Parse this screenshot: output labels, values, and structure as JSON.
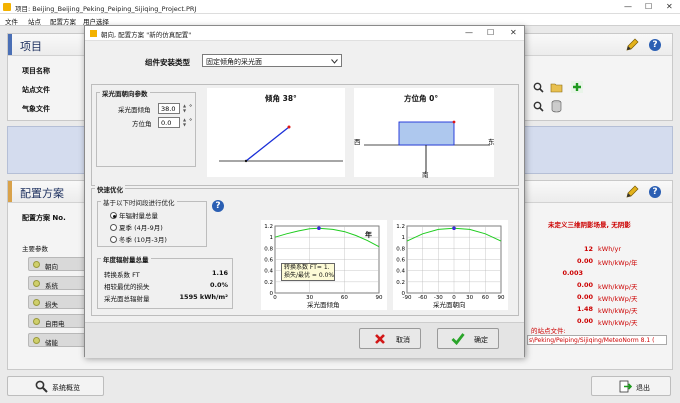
{
  "window": {
    "title": "项目:  Beijing_Beijing_Peking_Peiping_Sijiqing_Project.PRJ",
    "minimize": "—",
    "maximize": "☐",
    "close": "✕"
  },
  "menu": {
    "items": [
      "文件",
      "站点",
      "配置方案",
      "用户选择"
    ]
  },
  "project_panel": {
    "title": "项目",
    "rows": [
      "项目名称",
      "站点文件",
      "气象文件"
    ]
  },
  "config_panel": {
    "title": "配置方案",
    "config_label": "配置方案 No.",
    "main_params": "主要参数",
    "items": [
      "朝向",
      "系统",
      "损失",
      "自用电",
      "储能"
    ],
    "right_heading": "未定义三维阴影场景, 无阴影",
    "right_values": [
      {
        "value": "12",
        "unit": "kWh/yr"
      },
      {
        "value": "0.00",
        "unit": "kWh/kWp/年"
      },
      {
        "value": "0.003",
        "unit": ""
      },
      {
        "value": "0.00",
        "unit": "kWh/kWp/天"
      },
      {
        "value": "0.00",
        "unit": "kWh/kWp/天"
      },
      {
        "value": "1.48",
        "unit": "kWh/kWp/天"
      },
      {
        "value": "0.00",
        "unit": "kWh/kWp/天"
      }
    ],
    "site_file_label": "的站点文件:",
    "site_file_value": "s\\Peking/Peiping/Sijiqing/MeteoNorm 8.1 ("
  },
  "bottom": {
    "overview": "系统概览",
    "exit": "退出"
  },
  "dialog": {
    "title": "朝向, 配置方案 \"新的仿真配置\"",
    "install_type_label": "组件安装类型",
    "install_type_value": "固定倾角的采光面",
    "orientation_group": "采光面朝向参数",
    "tilt_label": "采光面倾角",
    "tilt_value": "38.0",
    "azimuth_label": "方位角",
    "azimuth_value": "0.0",
    "deg": "°",
    "tilt_fig_label": "倾角 38°",
    "azimuth_fig_label": "方位角 0°",
    "west": "西",
    "east": "东",
    "south": "南",
    "quick_opt": "快速优化",
    "opt_basis_group": "基于以下时间段进行优化",
    "opt_options": [
      "年辐射量总量",
      "夏季 (4月-9月)",
      "冬季 (10月-3月)"
    ],
    "irradiation_group": "年度辐射量总量",
    "transpos_label": "转换系数 FT",
    "transpos_value": "1.16",
    "loss_label": "相较最优的损失",
    "loss_value": "0.0%",
    "global_label": "采光面总辐射量",
    "global_value": "1595 kWh/m²",
    "chart1_xlabel": "采光面倾角",
    "chart2_xlabel": "采光面朝向",
    "chart1_corner": "年",
    "tooltip_line1": "转换系数 FT= 1.",
    "tooltip_line2": "损失/最优 = 0.0%",
    "cancel": "取消",
    "ok": "确定"
  },
  "chart_data": [
    {
      "type": "line",
      "x": [
        0,
        10,
        20,
        30,
        38,
        50,
        60,
        70,
        80,
        90
      ],
      "values": [
        1.0,
        1.06,
        1.11,
        1.15,
        1.16,
        1.14,
        1.1,
        1.03,
        0.94,
        0.83
      ],
      "marker_x": 38,
      "xlabel": "采光面倾角",
      "ylim": [
        0,
        1.2
      ],
      "xlim": [
        0,
        90
      ],
      "xticks": [
        0,
        30,
        60,
        90
      ],
      "yticks": [
        0,
        0.2,
        0.4,
        0.6,
        0.8,
        1.0,
        1.2
      ]
    },
    {
      "type": "line",
      "x": [
        -90,
        -60,
        -30,
        0,
        30,
        60,
        90
      ],
      "values": [
        0.93,
        1.06,
        1.14,
        1.16,
        1.14,
        1.06,
        0.93
      ],
      "marker_x": 0,
      "xlabel": "采光面朝向",
      "ylim": [
        0,
        1.2
      ],
      "xlim": [
        -90,
        90
      ],
      "xticks": [
        -90,
        -60,
        -30,
        0,
        30,
        60,
        90
      ],
      "yticks": [
        0,
        0.2,
        0.4,
        0.6,
        0.8,
        1.0,
        1.2
      ]
    }
  ]
}
